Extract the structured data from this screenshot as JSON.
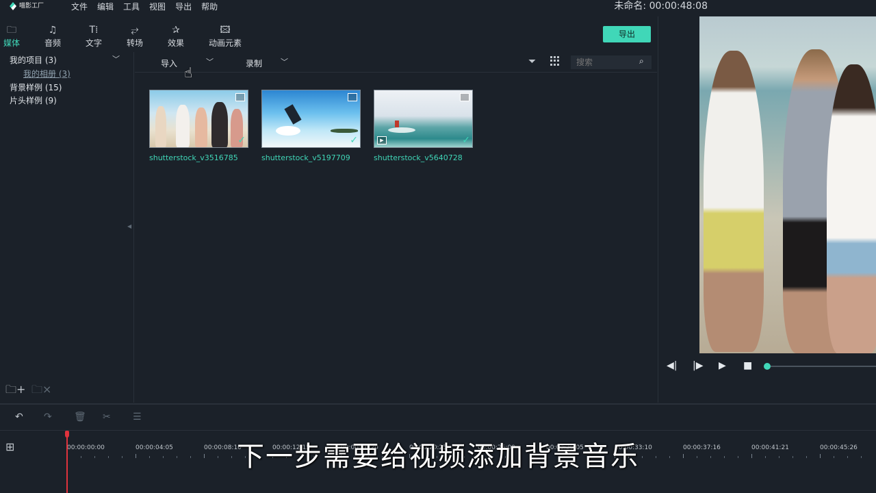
{
  "menubar": {
    "logo_text": "喵影工厂",
    "items": [
      "文件",
      "编辑",
      "工具",
      "视图",
      "导出",
      "帮助"
    ],
    "project_title": "未命名: 00:00:48:08"
  },
  "tabs": [
    {
      "label": "媒体",
      "icon": "folder-icon"
    },
    {
      "label": "音频",
      "icon": "music-note-icon"
    },
    {
      "label": "文字",
      "icon": "text-icon"
    },
    {
      "label": "转场",
      "icon": "transition-icon"
    },
    {
      "label": "效果",
      "icon": "effects-icon"
    },
    {
      "label": "动画元素",
      "icon": "image-icon"
    }
  ],
  "export_label": "导出",
  "sidebar": {
    "items": [
      {
        "label": "我的项目 (3)"
      },
      {
        "label": "我的相册 (3)"
      },
      {
        "label": "背景样例 (15)"
      },
      {
        "label": "片头样例 (9)"
      }
    ]
  },
  "media_toolbar": {
    "import_label": "导入",
    "record_label": "录制",
    "search_placeholder": "搜索"
  },
  "clips": [
    {
      "name": "shutterstock_v3516785"
    },
    {
      "name": "shutterstock_v5197709"
    },
    {
      "name": "shutterstock_v5640728"
    }
  ],
  "timeline": {
    "ticks": [
      "00:00:00:00",
      "00:00:04:05",
      "00:00:08:10",
      "00:00:12:15",
      "00:00:16:20",
      "00:00:20:25",
      "00:00:25:00",
      "00:00:29:05",
      "00:00:33:10",
      "00:00:37:16",
      "00:00:41:21",
      "00:00:45:26"
    ]
  },
  "subtitle": "下一步需要给视频添加背景音乐",
  "colors": {
    "accent": "#40d7b8",
    "playhead": "#e0333d",
    "background": "#1b2129"
  }
}
